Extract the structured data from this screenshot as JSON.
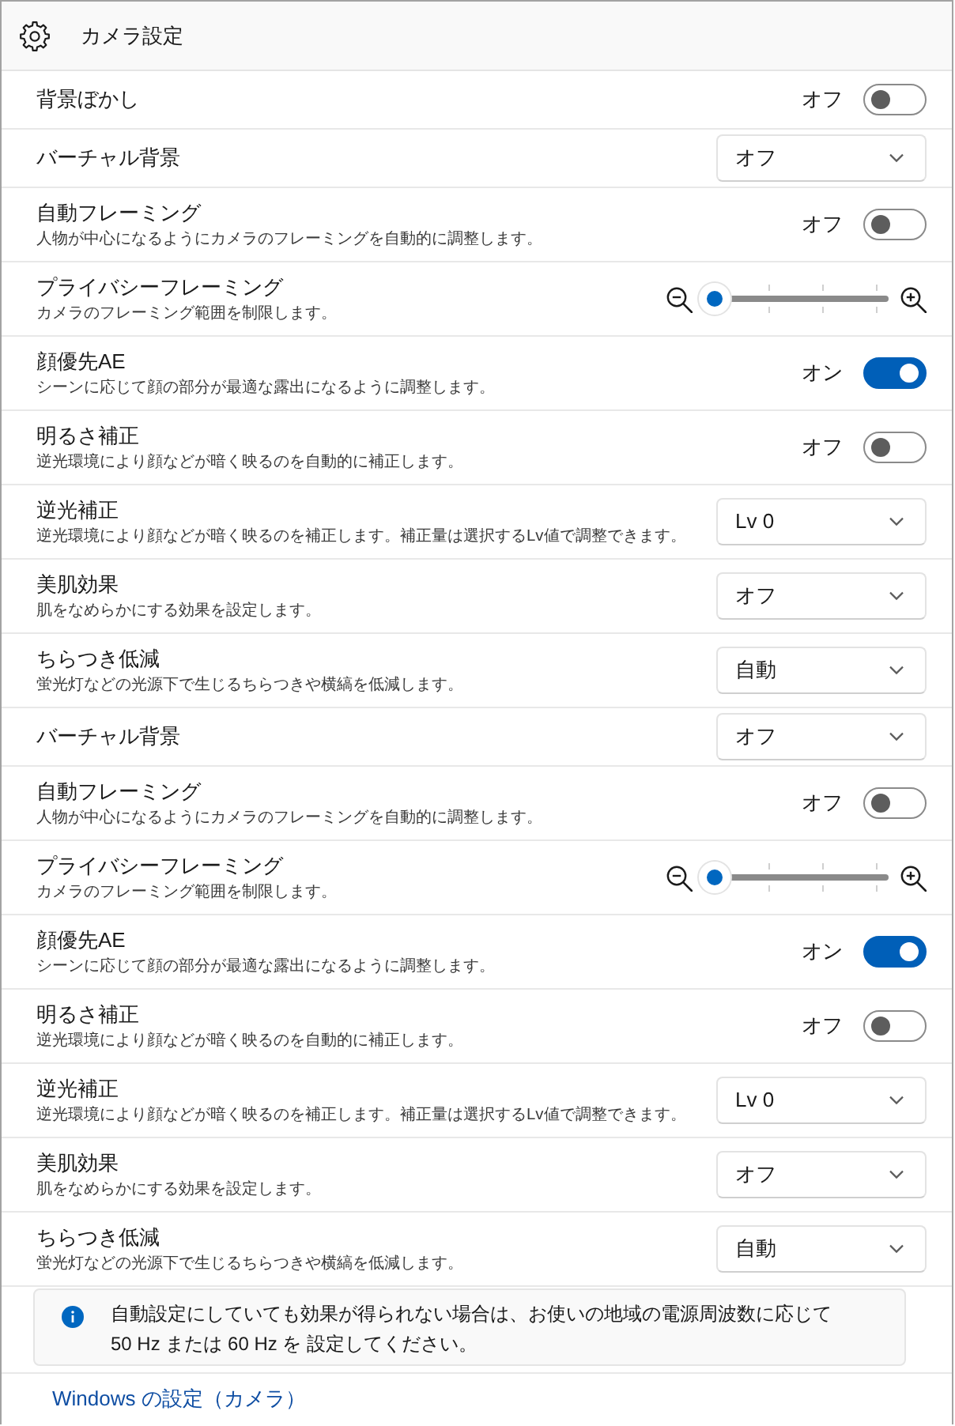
{
  "window": {
    "title": "カメラ設定"
  },
  "settings": [
    {
      "kind": "toggle",
      "label": "背景ぼかし",
      "status": "オフ",
      "on": false
    },
    {
      "kind": "dropdown",
      "label": "バーチャル背景",
      "value": "オフ"
    },
    {
      "kind": "toggle",
      "label": "自動フレーミング",
      "description": "人物が中心になるようにカメラのフレーミングを自動的に調整します。",
      "status": "オフ",
      "on": false
    },
    {
      "kind": "slider",
      "label": "プライバシーフレーミング",
      "description": "カメラのフレーミング範囲を制限します。",
      "level": 0
    },
    {
      "kind": "toggle",
      "label": "顔優先AE",
      "description": "シーンに応じて顔の部分が最適な露出になるように調整します。",
      "status": "オン",
      "on": true
    },
    {
      "kind": "toggle",
      "label": "明るさ補正",
      "description": "逆光環境により顔などが暗く映るのを自動的に補正します。",
      "status": "オフ",
      "on": false
    },
    {
      "kind": "dropdown",
      "label": "逆光補正",
      "description": "逆光環境により顔などが暗く映るのを補正します。補正量は選択するLv値で調整できます。",
      "value": "Lv 0"
    },
    {
      "kind": "dropdown",
      "label": "美肌効果",
      "description": "肌をなめらかにする効果を設定します。",
      "value": "オフ"
    },
    {
      "kind": "dropdown",
      "label": "ちらつき低減",
      "description": "蛍光灯などの光源下で生じるちらつきや横縞を低減します。",
      "value": "自動"
    },
    {
      "kind": "dropdown",
      "label": "バーチャル背景",
      "value": "オフ"
    },
    {
      "kind": "toggle",
      "label": "自動フレーミング",
      "description": "人物が中心になるようにカメラのフレーミングを自動的に調整します。",
      "status": "オフ",
      "on": false
    },
    {
      "kind": "slider",
      "label": "プライバシーフレーミング",
      "description": "カメラのフレーミング範囲を制限します。",
      "level": 0
    },
    {
      "kind": "toggle",
      "label": "顔優先AE",
      "description": "シーンに応じて顔の部分が最適な露出になるように調整します。",
      "status": "オン",
      "on": true
    },
    {
      "kind": "toggle",
      "label": "明るさ補正",
      "description": "逆光環境により顔などが暗く映るのを自動的に補正します。",
      "status": "オフ",
      "on": false
    },
    {
      "kind": "dropdown",
      "label": "逆光補正",
      "description": "逆光環境により顔などが暗く映るのを補正します。補正量は選択するLv値で調整できます。",
      "value": "Lv 0"
    },
    {
      "kind": "dropdown",
      "label": "美肌効果",
      "description": "肌をなめらかにする効果を設定します。",
      "value": "オフ"
    },
    {
      "kind": "dropdown",
      "label": "ちらつき低減",
      "description": "蛍光灯などの光源下で生じるちらつきや横縞を低減します。",
      "value": "自動"
    }
  ],
  "info": {
    "text": "自動設定にしていても効果が得られない場合は、お使いの地域の電源周波数に応じて\n50 Hz または 60 Hz を 設定してください。"
  },
  "link": "Windows の設定（カメラ）"
}
